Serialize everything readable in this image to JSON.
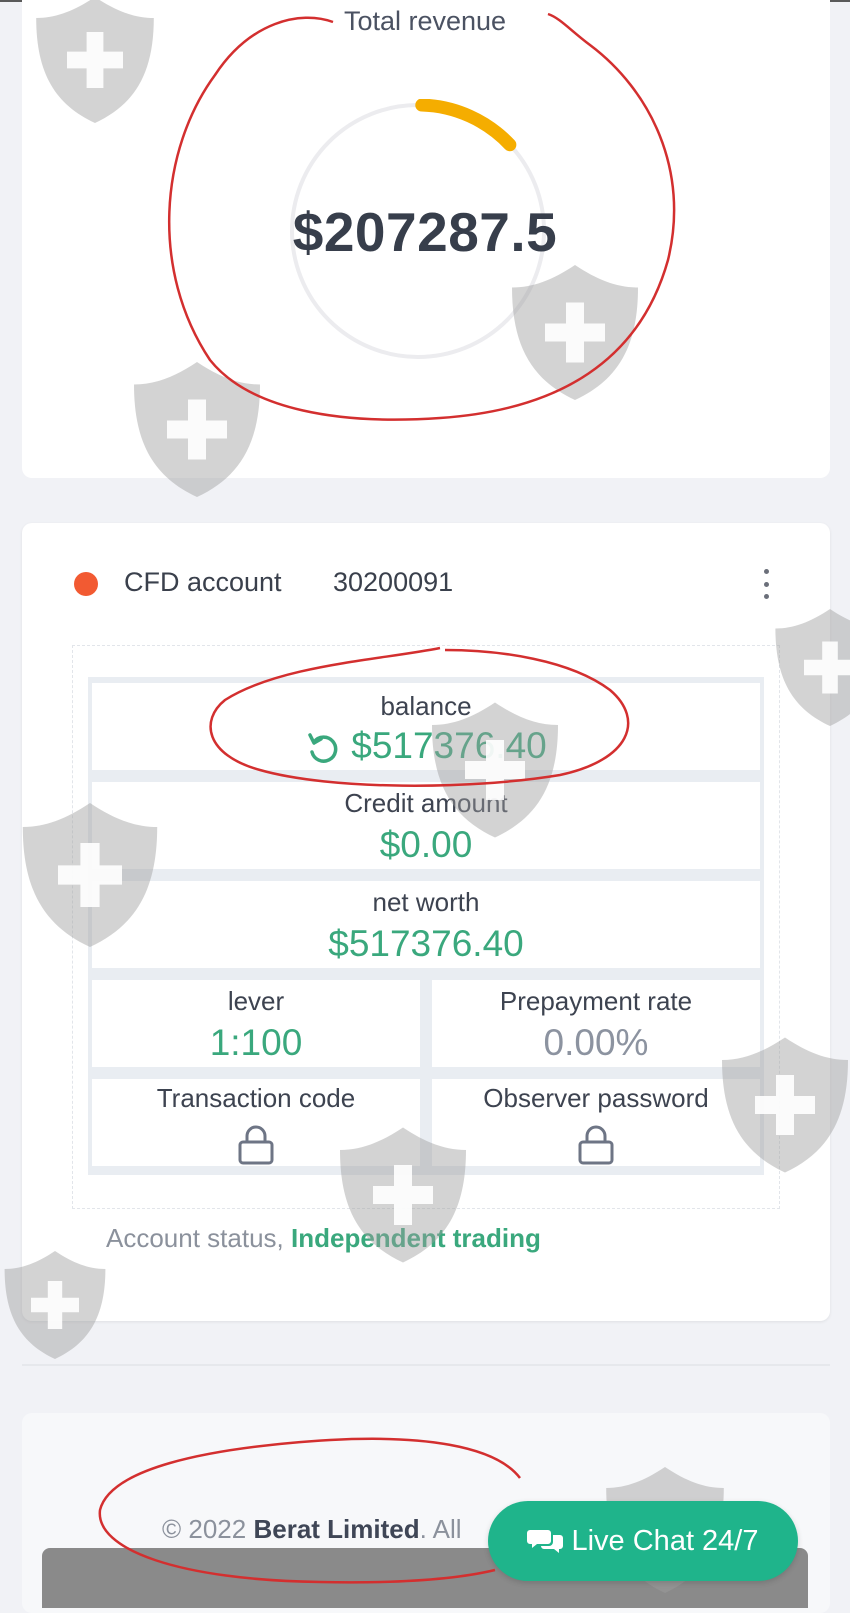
{
  "revenue": {
    "title": "Total revenue",
    "value": "$207287.5",
    "gauge_fraction": 0.13,
    "gauge_color": "#f5ad00"
  },
  "account": {
    "status_dot_color": "#f25a32",
    "label": "CFD account",
    "number": "30200091",
    "menu_icon": "more-vertical-icon"
  },
  "metrics": {
    "balance": {
      "label": "balance",
      "value": "$517376.40",
      "icon": "refresh-icon"
    },
    "credit": {
      "label": "Credit amount",
      "value": "$0.00"
    },
    "net_worth": {
      "label": "net worth",
      "value": "$517376.40"
    },
    "lever": {
      "label": "lever",
      "value": "1:100"
    },
    "prepayment": {
      "label": "Prepayment rate",
      "value": "0.00%"
    },
    "transaction_code": {
      "label": "Transaction code",
      "icon": "lock-icon"
    },
    "observer_password": {
      "label": "Observer password",
      "icon": "lock-icon"
    }
  },
  "status": {
    "label": "Account status,",
    "value": "Independent trading"
  },
  "footer": {
    "prefix": "© 2022",
    "company": "Berat Limited",
    "suffix": ". All"
  },
  "chat": {
    "label": "Live Chat 24/7",
    "icon": "chat-bubbles-icon"
  },
  "colors": {
    "accent_green": "#3aa87d",
    "chat_green": "#1fb48b",
    "background": "#f1f2f6"
  }
}
